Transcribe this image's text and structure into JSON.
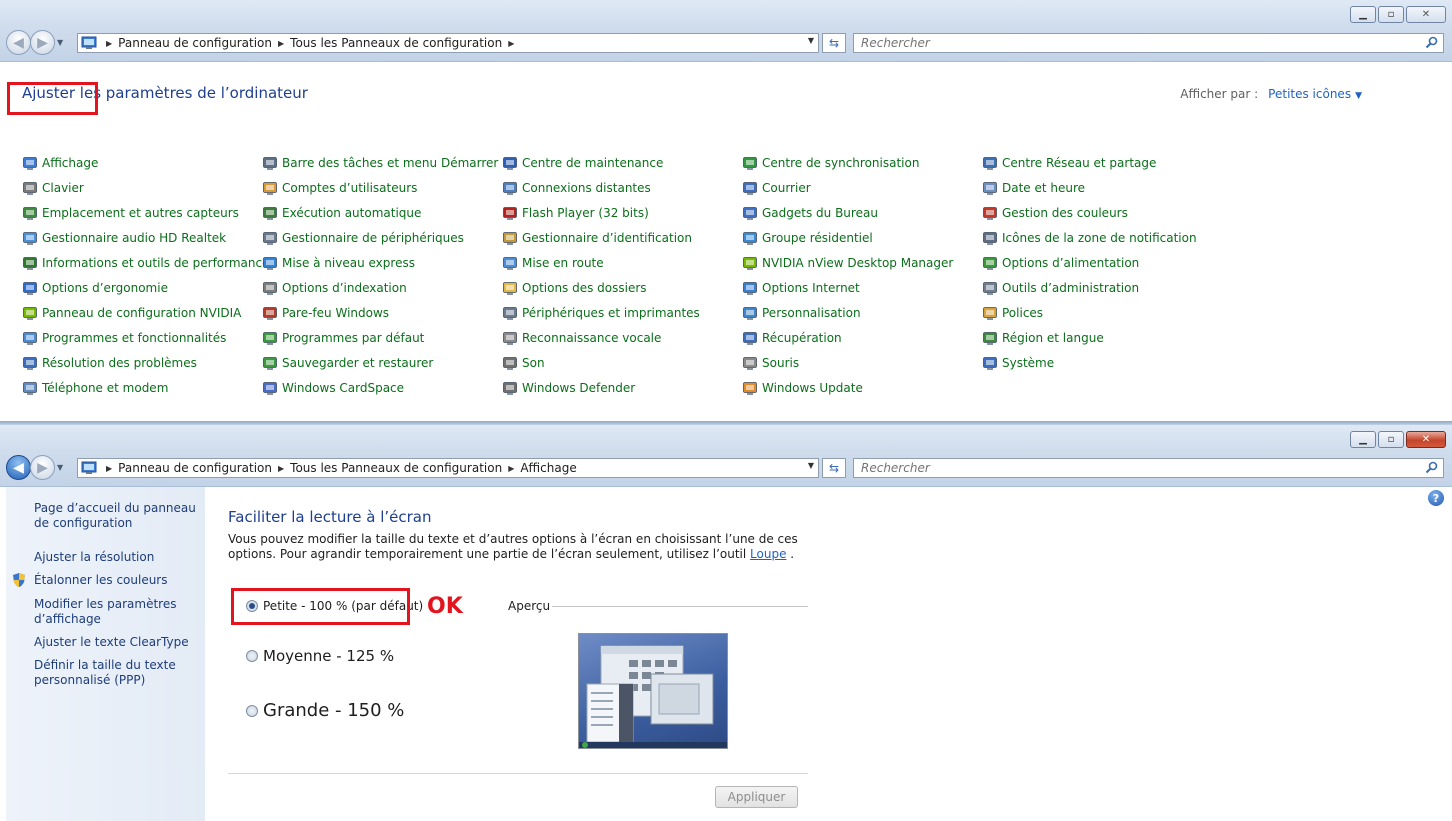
{
  "window_top": {
    "address": {
      "crumbs": [
        "Panneau de configuration",
        "Tous les Panneaux de configuration"
      ]
    },
    "search_placeholder": "Rechercher",
    "page_title": "Ajuster les paramètres de l’ordinateur",
    "view_by": {
      "label": "Afficher par :",
      "value": "Petites icônes"
    },
    "items": [
      {
        "label": "Affichage",
        "icon": "display-icon",
        "color": "#3a7bd5"
      },
      {
        "label": "Clavier",
        "icon": "keyboard-icon",
        "color": "#7a7a7a"
      },
      {
        "label": "Emplacement et autres capteurs",
        "icon": "sensor-icon",
        "color": "#3d8c3d"
      },
      {
        "label": "Gestionnaire audio HD Realtek",
        "icon": "audio-icon",
        "color": "#4a90d9"
      },
      {
        "label": "Informations et outils de performance",
        "icon": "performance-icon",
        "color": "#2f7a2f"
      },
      {
        "label": "Options d’ergonomie",
        "icon": "ergonomics-icon",
        "color": "#2d6ad4"
      },
      {
        "label": "Panneau de configuration NVIDIA",
        "icon": "nvidia-icon",
        "color": "#76b900"
      },
      {
        "label": "Programmes et fonctionnalités",
        "icon": "programs-icon",
        "color": "#4c8bd6"
      },
      {
        "label": "Résolution des problèmes",
        "icon": "troubleshoot-icon",
        "color": "#3a6fbf"
      },
      {
        "label": "Téléphone et modem",
        "icon": "phone-icon",
        "color": "#5f8bbf"
      },
      {
        "label": "Barre des tâches et menu Démarrer",
        "icon": "taskbar-icon",
        "color": "#5c6f87"
      },
      {
        "label": "Comptes d’utilisateurs",
        "icon": "users-icon",
        "color": "#d99a3a"
      },
      {
        "label": "Exécution automatique",
        "icon": "autoplay-icon",
        "color": "#3c7d3c"
      },
      {
        "label": "Gestionnaire de périphériques",
        "icon": "device-manager-icon",
        "color": "#6a7a8c"
      },
      {
        "label": "Mise à niveau express",
        "icon": "windows-upgrade-icon",
        "color": "#2f82d8"
      },
      {
        "label": "Options d’indexation",
        "icon": "indexing-icon",
        "color": "#7d7d7d"
      },
      {
        "label": "Pare-feu Windows",
        "icon": "firewall-icon",
        "color": "#b23b2a"
      },
      {
        "label": "Programmes par défaut",
        "icon": "default-programs-icon",
        "color": "#3a9b3a"
      },
      {
        "label": "Sauvegarder et restaurer",
        "icon": "backup-icon",
        "color": "#3b9a3b"
      },
      {
        "label": "Windows CardSpace",
        "icon": "cardspace-icon",
        "color": "#4a6bc7"
      },
      {
        "label": "Centre de maintenance",
        "icon": "flag-icon",
        "color": "#2e5fb5"
      },
      {
        "label": "Connexions distantes",
        "icon": "remoteapp-icon",
        "color": "#4a7fc0"
      },
      {
        "label": "Flash Player (32 bits)",
        "icon": "flash-icon",
        "color": "#b3231e"
      },
      {
        "label": "Gestionnaire d’identification",
        "icon": "credential-icon",
        "color": "#c29a3c"
      },
      {
        "label": "Mise en route",
        "icon": "getting-started-icon",
        "color": "#4b8ed6"
      },
      {
        "label": "Options des dossiers",
        "icon": "folder-options-icon",
        "color": "#e3b84a"
      },
      {
        "label": "Périphériques et imprimantes",
        "icon": "printer-icon",
        "color": "#6b7b8f"
      },
      {
        "label": "Reconnaissance vocale",
        "icon": "microphone-icon",
        "color": "#8a8a8a"
      },
      {
        "label": "Son",
        "icon": "speaker-icon",
        "color": "#707070"
      },
      {
        "label": "Windows Defender",
        "icon": "defender-icon",
        "color": "#6f6f6f"
      },
      {
        "label": "Centre de synchronisation",
        "icon": "sync-icon",
        "color": "#2f9a3d"
      },
      {
        "label": "Courrier",
        "icon": "mail-icon",
        "color": "#3b6ebd"
      },
      {
        "label": "Gadgets du Bureau",
        "icon": "gadgets-icon",
        "color": "#3e6fc0"
      },
      {
        "label": "Groupe résidentiel",
        "icon": "homegroup-icon",
        "color": "#3a8ad6"
      },
      {
        "label": "NVIDIA nView Desktop Manager",
        "icon": "nview-icon",
        "color": "#76b900"
      },
      {
        "label": "Options Internet",
        "icon": "internet-icon",
        "color": "#3b7ed0"
      },
      {
        "label": "Personnalisation",
        "icon": "personalization-icon",
        "color": "#3f86c9"
      },
      {
        "label": "Récupération",
        "icon": "recovery-icon",
        "color": "#3a6fbf"
      },
      {
        "label": "Souris",
        "icon": "mouse-icon",
        "color": "#8a8a8a"
      },
      {
        "label": "Windows Update",
        "icon": "windows-update-icon",
        "color": "#e38b2a"
      },
      {
        "label": "Centre Réseau et partage",
        "icon": "network-icon",
        "color": "#3d6fb4"
      },
      {
        "label": "Date et heure",
        "icon": "clock-icon",
        "color": "#6d8fbf"
      },
      {
        "label": "Gestion des couleurs",
        "icon": "color-management-icon",
        "color": "#c0392b"
      },
      {
        "label": "Icônes de la zone de notification",
        "icon": "notification-icon",
        "color": "#5e6f85"
      },
      {
        "label": "Options d’alimentation",
        "icon": "power-icon",
        "color": "#3a9a3a"
      },
      {
        "label": "Outils d’administration",
        "icon": "admin-tools-icon",
        "color": "#6f7f90"
      },
      {
        "label": "Polices",
        "icon": "fonts-icon",
        "color": "#d9a33a"
      },
      {
        "label": "Région et langue",
        "icon": "region-icon",
        "color": "#3b8a3b"
      },
      {
        "label": "Système",
        "icon": "system-icon",
        "color": "#3a6fbf"
      }
    ]
  },
  "window_bottom": {
    "address": {
      "crumbs": [
        "Panneau de configuration",
        "Tous les Panneaux de configuration",
        "Affichage"
      ]
    },
    "search_placeholder": "Rechercher",
    "sidebar": {
      "home": "Page d’accueil du panneau de configuration",
      "links": [
        "Ajuster la résolution",
        "Étalonner les couleurs",
        "Modifier les paramètres d’affichage",
        "Ajuster le texte ClearType",
        "Définir la taille du texte personnalisé (PPP)"
      ]
    },
    "section_title": "Faciliter la lecture à l’écran",
    "description": "Vous pouvez modifier la taille du texte et d’autres options à l’écran en choisissant l’une de ces options. Pour agrandir temporairement une partie de l’écran seulement, utilisez l’outil",
    "description_link": "Loupe",
    "description_end": " .",
    "options": [
      {
        "label": "Petite - 100 % (par défaut)",
        "selected": true
      },
      {
        "label": "Moyenne - 125 %",
        "selected": false
      },
      {
        "label": "Grande - 150 %",
        "selected": false
      }
    ],
    "annotation": "OK",
    "preview_label": "Aperçu",
    "apply_label": "Appliquer",
    "help_glyph": "?"
  },
  "colors": {
    "link_green": "#0b6e1a",
    "title_blue": "#1e3f8f",
    "highlight_red": "#e3141d"
  }
}
